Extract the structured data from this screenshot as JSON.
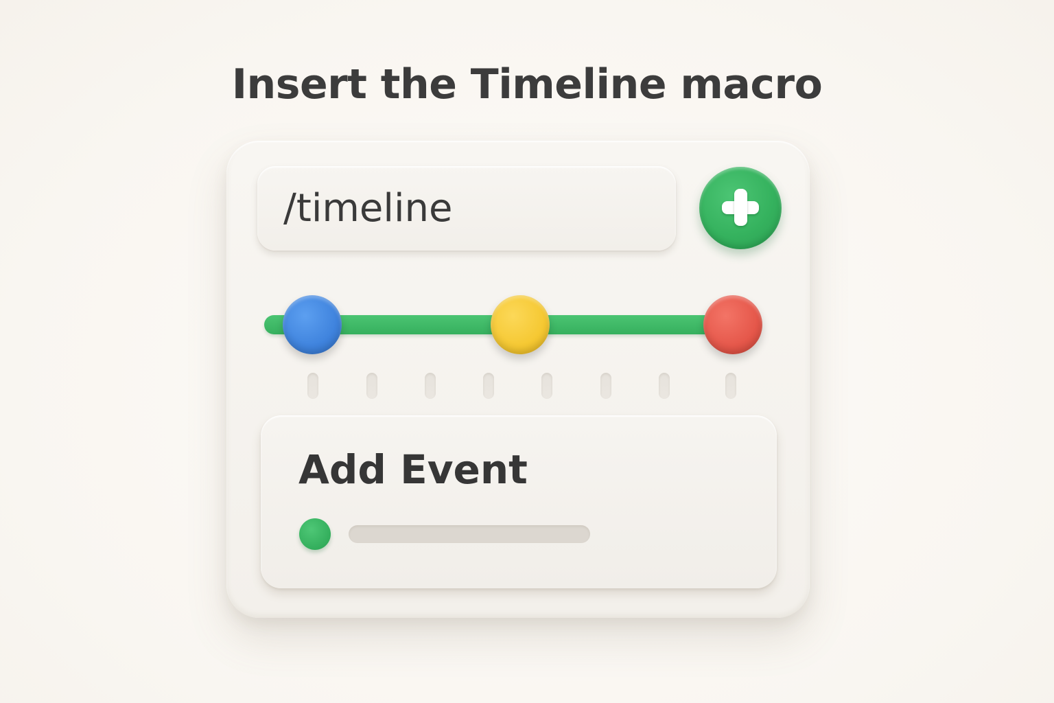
{
  "heading": "Insert the Timeline macro",
  "search": {
    "value": "/timeline"
  },
  "add_button": {
    "icon": "plus-icon",
    "color": "#35b25e"
  },
  "timeline": {
    "track_color": "#3fb966",
    "markers": [
      {
        "name": "blue",
        "color": "#3f83dd"
      },
      {
        "name": "yellow",
        "color": "#f5c832"
      },
      {
        "name": "red",
        "color": "#e5574a"
      }
    ],
    "tick_count": 8
  },
  "event_card": {
    "title": "Add Event",
    "dot_color": "#33ae5c"
  }
}
